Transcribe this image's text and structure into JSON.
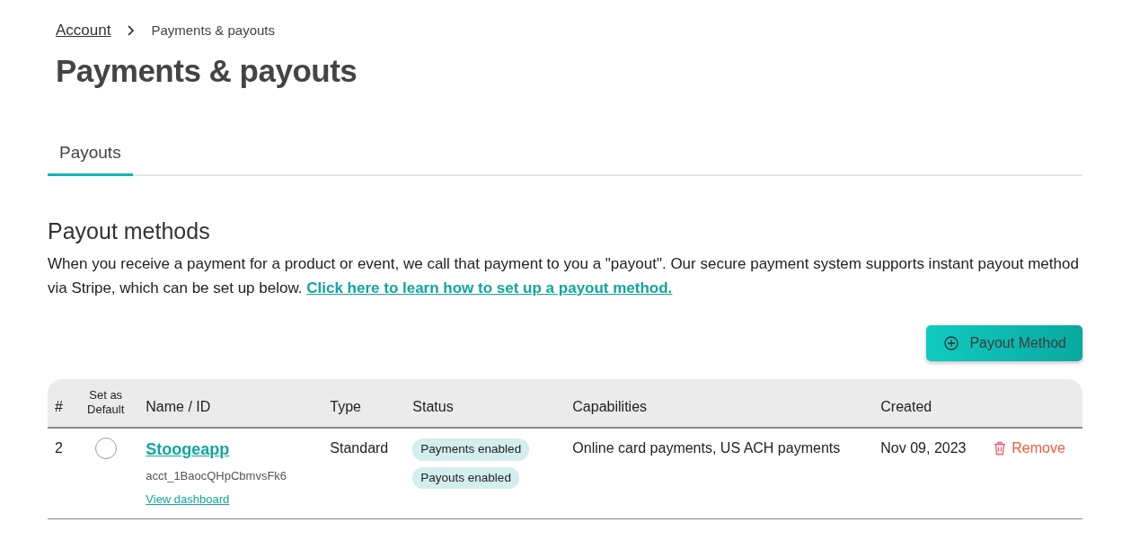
{
  "breadcrumb": [
    {
      "label": "Account",
      "link": true
    },
    {
      "label": "Payments & payouts",
      "link": false
    }
  ],
  "title": "Payments & payouts",
  "tabs": [
    {
      "label": "Payouts",
      "selected": true
    }
  ],
  "section": {
    "heading": "Payout methods",
    "description": "When you receive a payment for a product or event, we call that payment to you a \"payout\". Our secure payment system supports instant payout method via Stripe, which can be set up below.",
    "link": "Click here to learn how to set up a payout method."
  },
  "add_button": "Payout Method",
  "table": {
    "columns": [
      "#",
      "Set as Default",
      "Name / ID",
      "Type",
      "Status",
      "Capabilities",
      "Created"
    ],
    "rows": [
      {
        "number": "2",
        "default": {
          "selected": false
        },
        "name": "Stoogeapp",
        "id": "acct_1BaocQHpCbmvsFk6",
        "dashboard_link": "View dashboard",
        "type": "Standard",
        "status": [
          "Payments enabled",
          "Payouts enabled"
        ],
        "capabilities": "Online card payments, US ACH payments",
        "created": "Nov 09, 2023",
        "action": "Remove"
      }
    ]
  }
}
